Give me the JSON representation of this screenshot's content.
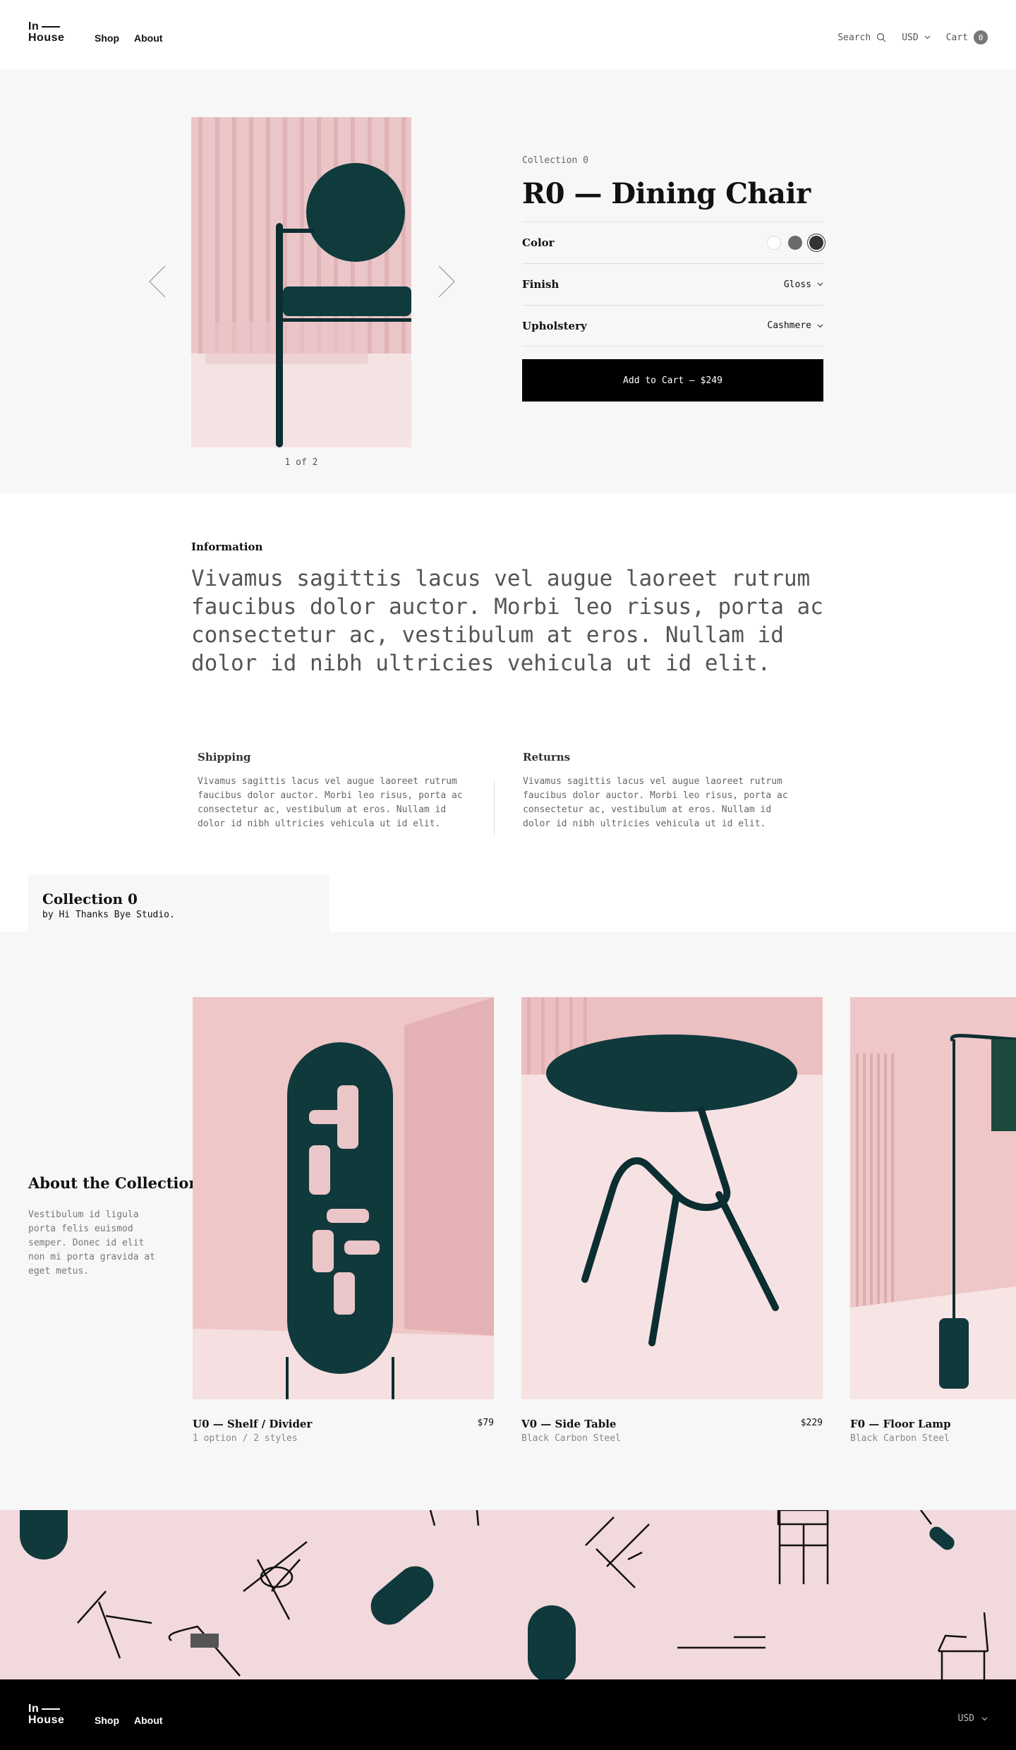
{
  "header": {
    "logo_line1": "In",
    "logo_line2": "House",
    "nav": [
      "Shop",
      "About"
    ],
    "search_label": "Search",
    "currency": "USD",
    "cart_label": "Cart",
    "cart_count": "0"
  },
  "product": {
    "image_counter": "1 of 2",
    "collection_label": "Collection 0",
    "title": "R0 — Dining Chair",
    "options": [
      {
        "label": "Color",
        "type": "swatches"
      },
      {
        "label": "Finish",
        "value": "Gloss"
      },
      {
        "label": "Upholstery",
        "value": "Cashmere"
      }
    ],
    "color_swatches": [
      "#ffffff",
      "#6b6b6b",
      "#333333"
    ],
    "selected_swatch_index": 2,
    "add_to_cart": "Add to Cart — $249"
  },
  "information": {
    "heading": "Information",
    "body": "Vivamus sagittis lacus vel augue laoreet rutrum faucibus dolor auctor. Morbi leo risus, porta ac consectetur ac, vestibulum at eros. Nullam id dolor id nibh ultricies vehicula ut id elit.",
    "shipping": {
      "heading": "Shipping",
      "body": "Vivamus sagittis lacus vel augue laoreet rutrum faucibus dolor auctor. Morbi leo risus, porta ac consectetur ac, vestibulum at eros. Nullam id dolor id nibh ultricies vehicula ut id elit."
    },
    "returns": {
      "heading": "Returns",
      "body": "Vivamus sagittis lacus vel augue laoreet rutrum faucibus dolor auctor. Morbi leo risus, porta ac consectetur ac, vestibulum at eros. Nullam id dolor id nibh ultricies vehicula ut id elit."
    }
  },
  "collection": {
    "title": "Collection 0",
    "byline": "by Hi Thanks Bye Studio.",
    "about_heading": "About the Collection",
    "about_body": "Vestibulum id ligula porta felis euismod semper. Donec id elit non mi porta gravida at eget metus.",
    "products": [
      {
        "name": "U0 — Shelf / Divider",
        "price": "$79",
        "sub": "1 option / 2 styles"
      },
      {
        "name": "V0 — Side Table",
        "price": "$229",
        "sub": "Black Carbon Steel"
      },
      {
        "name": "F0 — Floor Lamp",
        "price": "",
        "sub": "Black Carbon Steel"
      }
    ]
  },
  "footer": {
    "logo_line1": "In",
    "logo_line2": "House",
    "nav": [
      "Shop",
      "About"
    ],
    "currency": "USD"
  },
  "colors": {
    "accent_dark_green": "#10393c",
    "pink_bg": "#f2d9de",
    "footer_bg": "#000000"
  }
}
